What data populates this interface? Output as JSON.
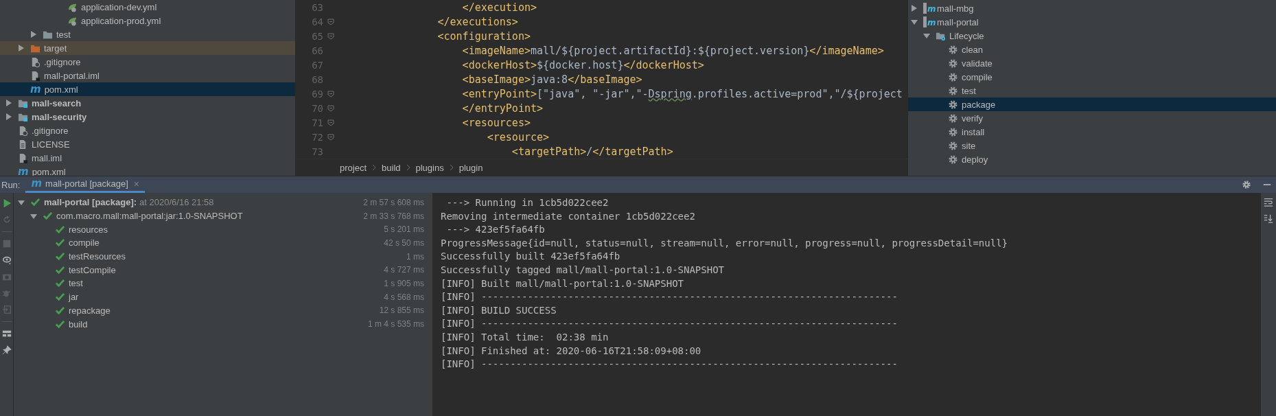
{
  "project_tree": [
    {
      "children": [
        {
          "children": [
            {
              "children": [
                {
                  "children": [
                    {
                      "label": "application-dev.yml",
                      "kind": "yml",
                      "selected": false
                    },
                    {
                      "label": "application-prod.yml",
                      "kind": "yml",
                      "selected": false
                    }
                  ]
                }
              ]
            },
            {
              "label": "test",
              "kind": "folder",
              "expanded": false,
              "selected": false
            }
          ]
        },
        {
          "label": "target",
          "kind": "excluded-folder",
          "expanded": false,
          "selected": false
        },
        {
          "label": ".gitignore",
          "kind": "ignore",
          "selected": false
        },
        {
          "label": "mall-portal.iml",
          "kind": "iml",
          "selected": false
        },
        {
          "label": "pom.xml",
          "kind": "maven",
          "glyph": "m",
          "selected": true
        }
      ]
    },
    {
      "label": "mall-search",
      "kind": "module",
      "expanded": false,
      "selected": false
    },
    {
      "label": "mall-security",
      "kind": "module",
      "expanded": false,
      "selected": false
    },
    {
      "label": ".gitignore",
      "kind": "ignore",
      "selected": false
    },
    {
      "label": "LICENSE",
      "kind": "text",
      "selected": false
    },
    {
      "label": "mall.iml",
      "kind": "iml",
      "selected": false
    },
    {
      "label": "pom.xml",
      "kind": "maven",
      "glyph": "m",
      "selected": false
    }
  ],
  "editor": {
    "lines": [
      {
        "number": "63",
        "fold_marker": false,
        "segments": [
          {
            "kind": "tag",
            "text": "                    </execution>"
          }
        ]
      },
      {
        "number": "64",
        "fold_marker": true,
        "segments": [
          {
            "kind": "tag",
            "text": "                </executions>"
          }
        ]
      },
      {
        "number": "65",
        "fold_marker": true,
        "segments": [
          {
            "kind": "tag",
            "text": "                <configuration>"
          }
        ]
      },
      {
        "number": "66",
        "fold_marker": false,
        "segments": [
          {
            "kind": "tag",
            "text": "                    <imageName>"
          },
          {
            "kind": "text",
            "text": "mall/${project.artifactId}:${project.version}"
          },
          {
            "kind": "tag",
            "text": "</imageName>"
          }
        ]
      },
      {
        "number": "67",
        "fold_marker": false,
        "segments": [
          {
            "kind": "tag",
            "text": "                    <dockerHost>"
          },
          {
            "kind": "text",
            "text": "${docker.host}"
          },
          {
            "kind": "tag",
            "text": "</dockerHost>"
          }
        ]
      },
      {
        "number": "68",
        "fold_marker": false,
        "segments": [
          {
            "kind": "tag",
            "text": "                    <baseImage>"
          },
          {
            "kind": "text",
            "text": "java:8"
          },
          {
            "kind": "tag",
            "text": "</baseImage>"
          }
        ]
      },
      {
        "number": "69",
        "fold_marker": true,
        "segments": [
          {
            "kind": "tag",
            "text": "                    <entryPoint>"
          },
          {
            "kind": "text",
            "text": "[\"java\", \"-jar\",\"-"
          },
          {
            "kind": "typo",
            "text": "Dspring"
          },
          {
            "kind": "text",
            "text": ".profiles.active=prod\",\"/${project"
          }
        ]
      },
      {
        "number": "70",
        "fold_marker": true,
        "segments": [
          {
            "kind": "tag",
            "text": "                    </entryPoint>"
          }
        ]
      },
      {
        "number": "71",
        "fold_marker": true,
        "segments": [
          {
            "kind": "tag",
            "text": "                    <resources>"
          }
        ]
      },
      {
        "number": "72",
        "fold_marker": true,
        "segments": [
          {
            "kind": "tag",
            "text": "                        <resource>"
          }
        ]
      },
      {
        "number": "73",
        "fold_marker": false,
        "segments": [
          {
            "kind": "tag",
            "text": "                            <targetPath>"
          },
          {
            "kind": "text",
            "text": "/"
          },
          {
            "kind": "tag",
            "text": "</targetPath>"
          }
        ]
      }
    ],
    "breadcrumbs": [
      "project",
      "build",
      "plugins",
      "plugin"
    ]
  },
  "maven_tree": [
    {
      "label": "mall-mbg",
      "kind": "maven-module",
      "glyph": "m",
      "expanded": false,
      "selected": false
    },
    {
      "label": "mall-portal",
      "kind": "maven-module",
      "glyph": "m",
      "expanded": true,
      "selected": false,
      "children": [
        {
          "label": "Lifecycle",
          "kind": "lifecycle",
          "expanded": true,
          "selected": false,
          "children": [
            {
              "label": "clean",
              "kind": "goal",
              "selected": false
            },
            {
              "label": "validate",
              "kind": "goal",
              "selected": false
            },
            {
              "label": "compile",
              "kind": "goal",
              "selected": false
            },
            {
              "label": "test",
              "kind": "goal",
              "selected": false
            },
            {
              "label": "package",
              "kind": "goal",
              "selected": true
            },
            {
              "label": "verify",
              "kind": "goal",
              "selected": false
            },
            {
              "label": "install",
              "kind": "goal",
              "selected": false
            },
            {
              "label": "site",
              "kind": "goal",
              "selected": false
            },
            {
              "label": "deploy",
              "kind": "goal",
              "selected": false
            }
          ]
        }
      ]
    }
  ],
  "run_panel": {
    "title": "Run:",
    "tabs": [
      {
        "label": "mall-portal [package]",
        "glyph": "m",
        "close": "×",
        "selected": true
      }
    ],
    "tree": [
      {
        "label": "mall-portal [package]:",
        "detail": "at 2020/6/16 21:58",
        "duration": "2 m 57 s 608 ms",
        "passed": true,
        "expanded": true,
        "children": [
          {
            "label": "com.macro.mall:mall-portal:jar:1.0-SNAPSHOT",
            "duration": "2 m 33 s 768 ms",
            "passed": true,
            "expanded": true,
            "children": [
              {
                "label": "resources",
                "duration": "5 s 201 ms",
                "passed": true
              },
              {
                "label": "compile",
                "duration": "42 s 50 ms",
                "passed": true
              },
              {
                "label": "testResources",
                "duration": "1 ms",
                "passed": true
              },
              {
                "label": "testCompile",
                "duration": "4 s 727 ms",
                "passed": true
              },
              {
                "label": "test",
                "duration": "1 s 905 ms",
                "passed": true
              },
              {
                "label": "jar",
                "duration": "4 s 568 ms",
                "passed": true
              },
              {
                "label": "repackage",
                "duration": "12 s 855 ms",
                "passed": true
              },
              {
                "label": "build",
                "duration": "1 m 4 s 535 ms",
                "passed": true
              }
            ]
          }
        ]
      }
    ],
    "console": [
      " ---> Running in 1cb5d022cee2",
      "Removing intermediate container 1cb5d022cee2",
      " ---> 423ef5fa64fb",
      "ProgressMessage{id=null, status=null, stream=null, error=null, progress=null, progressDetail=null}",
      "Successfully built 423ef5fa64fb",
      "Successfully tagged mall/mall-portal:1.0-SNAPSHOT",
      "[INFO] Built mall/mall-portal:1.0-SNAPSHOT",
      "[INFO] ------------------------------------------------------------------------",
      "[INFO] BUILD SUCCESS",
      "[INFO] ------------------------------------------------------------------------",
      "[INFO] Total time:  02:38 min",
      "[INFO] Finished at: 2020-06-16T21:58:09+08:00",
      "[INFO] ------------------------------------------------------------------------"
    ]
  }
}
